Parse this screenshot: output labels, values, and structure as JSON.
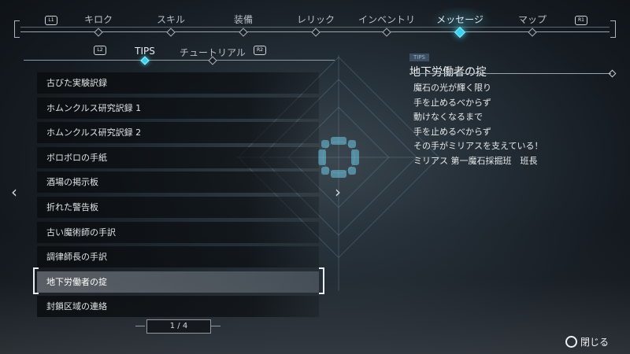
{
  "top_tabs": [
    {
      "label": "キロク",
      "active": false
    },
    {
      "label": "スキル",
      "active": false
    },
    {
      "label": "装備",
      "active": false
    },
    {
      "label": "レリック",
      "active": false
    },
    {
      "label": "インベントリ",
      "active": false
    },
    {
      "label": "メッセージ",
      "active": true
    },
    {
      "label": "マップ",
      "active": false
    }
  ],
  "top_hints": {
    "left": "L1",
    "right": "R1"
  },
  "sub_tabs": [
    {
      "label": "TIPS",
      "active": true
    },
    {
      "label": "チュートリアル",
      "active": false
    }
  ],
  "sub_hints": {
    "left": "L2",
    "right": "R2"
  },
  "list_items": [
    "古びた実験訳録",
    "ホムンクルス研究訳録 1",
    "ホムンクルス研究訳録 2",
    "ボロボロの手紙",
    "酒場の掲示板",
    "折れた警告板",
    "古い魔術師の手訳",
    "調律師長の手訳",
    "地下労働者の掟",
    "封鎖区域の連絡"
  ],
  "selected_index": 8,
  "pager": "1 / 4",
  "detail": {
    "tag": "TIPS",
    "title": "地下労働者の掟",
    "body": "魔石の光が輝く限り\n手を止めるべからず\n動けなくなるまで\n手を止めるべからず\nその手がミリアスを支えている！\nミリアス 第一魔石採掘班　班長"
  },
  "close_label": "閉じる",
  "accent_color": "#3fd0ea",
  "icons": {
    "prev": "chevron-left-icon",
    "next": "chevron-right-icon",
    "close": "circle-button-icon"
  }
}
